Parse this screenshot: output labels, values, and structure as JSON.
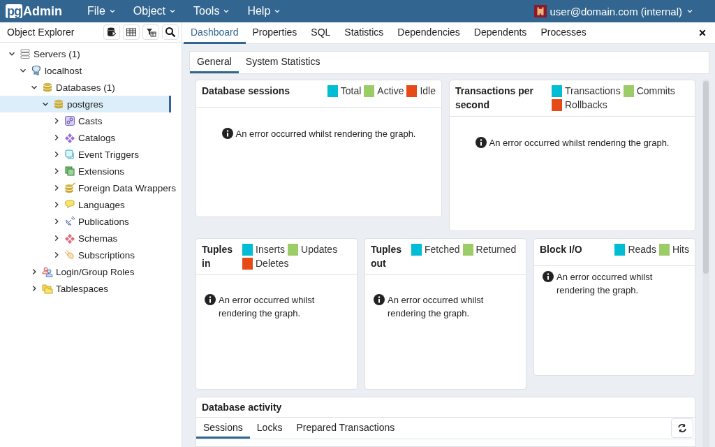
{
  "app": {
    "logo_mark": "pg",
    "logo_name": "Admin"
  },
  "menu": [
    {
      "label": "File"
    },
    {
      "label": "Object"
    },
    {
      "label": "Tools"
    },
    {
      "label": "Help"
    }
  ],
  "user": {
    "label": "user@domain.com (internal)"
  },
  "object_explorer": {
    "title": "Object Explorer",
    "tree": [
      {
        "label": "Servers (1)",
        "kind": "servers",
        "expanded": true,
        "selected": false,
        "children": [
          {
            "label": "localhost",
            "kind": "server",
            "expanded": true,
            "selected": false,
            "children": [
              {
                "label": "Databases (1)",
                "kind": "databases",
                "expanded": true,
                "selected": false,
                "children": [
                  {
                    "label": "postgres",
                    "kind": "database",
                    "expanded": true,
                    "selected": true,
                    "children": [
                      {
                        "label": "Casts",
                        "kind": "casts",
                        "expanded": false,
                        "selected": false
                      },
                      {
                        "label": "Catalogs",
                        "kind": "catalogs",
                        "expanded": false,
                        "selected": false
                      },
                      {
                        "label": "Event Triggers",
                        "kind": "triggers",
                        "expanded": false,
                        "selected": false
                      },
                      {
                        "label": "Extensions",
                        "kind": "extensions",
                        "expanded": false,
                        "selected": false
                      },
                      {
                        "label": "Foreign Data Wrappers",
                        "kind": "wrappers",
                        "expanded": false,
                        "selected": false
                      },
                      {
                        "label": "Languages",
                        "kind": "languages",
                        "expanded": false,
                        "selected": false
                      },
                      {
                        "label": "Publications",
                        "kind": "publications",
                        "expanded": false,
                        "selected": false
                      },
                      {
                        "label": "Schemas",
                        "kind": "schemas",
                        "expanded": false,
                        "selected": false
                      },
                      {
                        "label": "Subscriptions",
                        "kind": "subscriptions",
                        "expanded": false,
                        "selected": false
                      }
                    ]
                  }
                ]
              },
              {
                "label": "Login/Group Roles",
                "kind": "roles",
                "expanded": false,
                "selected": false
              },
              {
                "label": "Tablespaces",
                "kind": "tablespaces",
                "expanded": false,
                "selected": false
              }
            ]
          }
        ]
      }
    ]
  },
  "tabs": [
    {
      "label": "Dashboard",
      "selected": true
    },
    {
      "label": "Properties",
      "selected": false
    },
    {
      "label": "SQL",
      "selected": false
    },
    {
      "label": "Statistics",
      "selected": false
    },
    {
      "label": "Dependencies",
      "selected": false
    },
    {
      "label": "Dependents",
      "selected": false
    },
    {
      "label": "Processes",
      "selected": false
    }
  ],
  "subtabs": [
    {
      "label": "General",
      "selected": true
    },
    {
      "label": "System Statistics",
      "selected": false
    }
  ],
  "panel_rows": [
    {
      "panels": [
        {
          "title": "Database sessions",
          "legend": [
            {
              "label": "Total",
              "color": "#00bcd4"
            },
            {
              "label": "Active",
              "color": "#9ccc65"
            },
            {
              "label": "Idle",
              "color": "#e64a19"
            }
          ],
          "message": "An error occurred whilst rendering the graph."
        },
        {
          "title": "Transactions per second",
          "legend": [
            {
              "label": "Transactions",
              "color": "#00bcd4"
            },
            {
              "label": "Commits",
              "color": "#9ccc65"
            },
            {
              "label": "Rollbacks",
              "color": "#e64a19"
            }
          ],
          "message": "An error occurred whilst rendering the graph."
        }
      ]
    },
    {
      "panels": [
        {
          "title": "Tuples in",
          "legend": [
            {
              "label": "Inserts",
              "color": "#00bcd4"
            },
            {
              "label": "Updates",
              "color": "#9ccc65"
            },
            {
              "label": "Deletes",
              "color": "#e64a19"
            }
          ],
          "message": "An error occurred whilst rendering the graph."
        },
        {
          "title": "Tuples out",
          "legend": [
            {
              "label": "Fetched",
              "color": "#00bcd4"
            },
            {
              "label": "Returned",
              "color": "#9ccc65"
            }
          ],
          "message": "An error occurred whilst rendering the graph."
        },
        {
          "title": "Block I/O",
          "legend": [
            {
              "label": "Reads",
              "color": "#00bcd4"
            },
            {
              "label": "Hits",
              "color": "#9ccc65"
            }
          ],
          "message": "An error occurred whilst rendering the graph."
        }
      ]
    }
  ],
  "activity": {
    "title": "Database activity",
    "tabs": [
      {
        "label": "Sessions",
        "selected": true
      },
      {
        "label": "Locks",
        "selected": false
      },
      {
        "label": "Prepared Transactions",
        "selected": false
      }
    ]
  }
}
